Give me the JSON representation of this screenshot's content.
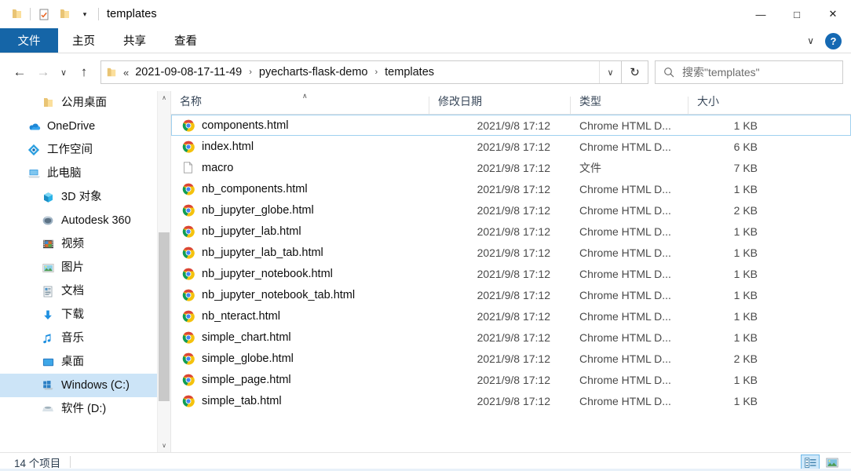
{
  "window": {
    "title": "templates",
    "quick_access": [
      {
        "name": "folder-icon",
        "label": "文件夹"
      },
      {
        "name": "properties-icon",
        "label": "属性"
      },
      {
        "name": "new-folder-icon",
        "label": "新建文件夹"
      }
    ],
    "qat_dropdown": "▾",
    "controls": {
      "minimize": "—",
      "maximize": "□",
      "close": "✕"
    }
  },
  "ribbon": {
    "tabs": [
      {
        "label": "文件",
        "active": true
      },
      {
        "label": "主页",
        "active": false
      },
      {
        "label": "共享",
        "active": false
      },
      {
        "label": "查看",
        "active": false
      }
    ],
    "expand_label": "∨",
    "help_label": "?"
  },
  "addressbar": {
    "back": "←",
    "forward": "→",
    "recent": "∨",
    "up": "↑",
    "lead": "«",
    "crumbs": [
      "2021-09-08-17-11-49",
      "pyecharts-flask-demo",
      "templates"
    ],
    "separator": "›",
    "dropdown": "∨",
    "refresh": "↻",
    "search_placeholder": "搜索\"templates\""
  },
  "sidebar": {
    "items": [
      {
        "label": "公用桌面",
        "icon": "folder-icon",
        "level": 2,
        "selected": false
      },
      {
        "label": "OneDrive",
        "icon": "onedrive-cloud-icon",
        "level": 1,
        "selected": false
      },
      {
        "label": "工作空间",
        "icon": "workspace-icon",
        "level": 1,
        "selected": false
      },
      {
        "label": "此电脑",
        "icon": "this-pc-icon",
        "level": 1,
        "selected": false
      },
      {
        "label": "3D 对象",
        "icon": "3d-objects-icon",
        "level": 2,
        "selected": false
      },
      {
        "label": "Autodesk 360",
        "icon": "autodesk-icon",
        "level": 2,
        "selected": false
      },
      {
        "label": "视频",
        "icon": "videos-icon",
        "level": 2,
        "selected": false
      },
      {
        "label": "图片",
        "icon": "pictures-icon",
        "level": 2,
        "selected": false
      },
      {
        "label": "文档",
        "icon": "documents-icon",
        "level": 2,
        "selected": false
      },
      {
        "label": "下载",
        "icon": "downloads-icon",
        "level": 2,
        "selected": false
      },
      {
        "label": "音乐",
        "icon": "music-icon",
        "level": 2,
        "selected": false
      },
      {
        "label": "桌面",
        "icon": "desktop-icon",
        "level": 2,
        "selected": false
      },
      {
        "label": "Windows (C:)",
        "icon": "windows-drive-icon",
        "level": 2,
        "selected": true
      },
      {
        "label": "软件 (D:)",
        "icon": "drive-icon",
        "level": 2,
        "selected": false
      }
    ],
    "scroll_up": "∧",
    "scroll_down": "∨"
  },
  "filelist": {
    "columns": [
      {
        "key": "name",
        "label": "名称"
      },
      {
        "key": "date",
        "label": "修改日期"
      },
      {
        "key": "type",
        "label": "类型"
      },
      {
        "key": "size",
        "label": "大小"
      }
    ],
    "sort_indicator": "∧",
    "rows": [
      {
        "name": "components.html",
        "date": "2021/9/8 17:12",
        "type": "Chrome HTML D...",
        "size": "1 KB",
        "icon": "chrome-icon",
        "focused": true
      },
      {
        "name": "index.html",
        "date": "2021/9/8 17:12",
        "type": "Chrome HTML D...",
        "size": "6 KB",
        "icon": "chrome-icon",
        "focused": false
      },
      {
        "name": "macro",
        "date": "2021/9/8 17:12",
        "type": "文件",
        "size": "7 KB",
        "icon": "generic-file-icon",
        "focused": false
      },
      {
        "name": "nb_components.html",
        "date": "2021/9/8 17:12",
        "type": "Chrome HTML D...",
        "size": "1 KB",
        "icon": "chrome-icon",
        "focused": false
      },
      {
        "name": "nb_jupyter_globe.html",
        "date": "2021/9/8 17:12",
        "type": "Chrome HTML D...",
        "size": "2 KB",
        "icon": "chrome-icon",
        "focused": false
      },
      {
        "name": "nb_jupyter_lab.html",
        "date": "2021/9/8 17:12",
        "type": "Chrome HTML D...",
        "size": "1 KB",
        "icon": "chrome-icon",
        "focused": false
      },
      {
        "name": "nb_jupyter_lab_tab.html",
        "date": "2021/9/8 17:12",
        "type": "Chrome HTML D...",
        "size": "1 KB",
        "icon": "chrome-icon",
        "focused": false
      },
      {
        "name": "nb_jupyter_notebook.html",
        "date": "2021/9/8 17:12",
        "type": "Chrome HTML D...",
        "size": "1 KB",
        "icon": "chrome-icon",
        "focused": false
      },
      {
        "name": "nb_jupyter_notebook_tab.html",
        "date": "2021/9/8 17:12",
        "type": "Chrome HTML D...",
        "size": "1 KB",
        "icon": "chrome-icon",
        "focused": false
      },
      {
        "name": "nb_nteract.html",
        "date": "2021/9/8 17:12",
        "type": "Chrome HTML D...",
        "size": "1 KB",
        "icon": "chrome-icon",
        "focused": false
      },
      {
        "name": "simple_chart.html",
        "date": "2021/9/8 17:12",
        "type": "Chrome HTML D...",
        "size": "1 KB",
        "icon": "chrome-icon",
        "focused": false
      },
      {
        "name": "simple_globe.html",
        "date": "2021/9/8 17:12",
        "type": "Chrome HTML D...",
        "size": "2 KB",
        "icon": "chrome-icon",
        "focused": false
      },
      {
        "name": "simple_page.html",
        "date": "2021/9/8 17:12",
        "type": "Chrome HTML D...",
        "size": "1 KB",
        "icon": "chrome-icon",
        "focused": false
      },
      {
        "name": "simple_tab.html",
        "date": "2021/9/8 17:12",
        "type": "Chrome HTML D...",
        "size": "1 KB",
        "icon": "chrome-icon",
        "focused": false
      }
    ]
  },
  "statusbar": {
    "item_count": "14 个项目",
    "views": [
      {
        "name": "details-view-button",
        "active": true
      },
      {
        "name": "large-icons-view-button",
        "active": false
      }
    ]
  },
  "colors": {
    "accent": "#1565a7",
    "selection": "#cce4f7",
    "focus_border": "#9fd0f0",
    "header_text": "#39485a"
  }
}
